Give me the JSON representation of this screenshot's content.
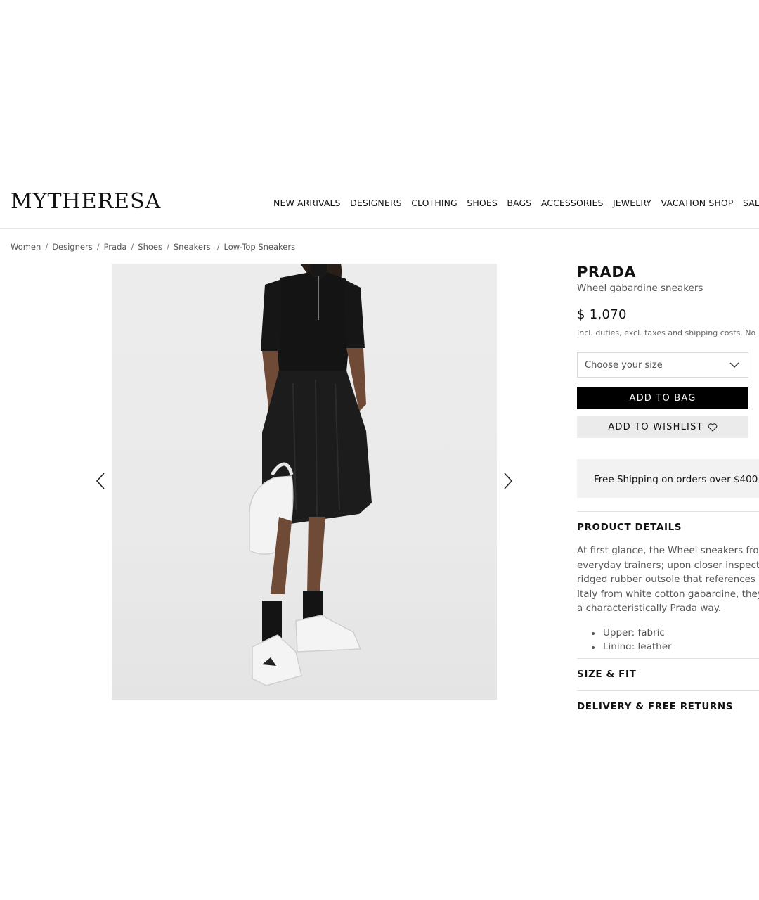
{
  "header": {
    "logo": "MYTHERESA",
    "nav": [
      "NEW ARRIVALS",
      "DESIGNERS",
      "CLOTHING",
      "SHOES",
      "BAGS",
      "ACCESSORIES",
      "JEWELRY",
      "VACATION SHOP",
      "SALE"
    ]
  },
  "breadcrumb": [
    "Women",
    "Designers",
    "Prada",
    "Shoes",
    "Sneakers",
    "Low-Top Sneakers"
  ],
  "product": {
    "brand": "PRADA",
    "name": "Wheel gabardine sneakers",
    "price": "$ 1,070",
    "price_note": "Incl. duties, excl. taxes and shipping costs. No",
    "size_placeholder": "Choose your size",
    "add_to_bag": "ADD TO BAG",
    "add_to_wishlist": "ADD TO WISHLIST",
    "shipping": "Free Shipping on orders over $400"
  },
  "details": {
    "title": "PRODUCT DETAILS",
    "description_lines": [
      "At first glance, the Wheel sneakers from P",
      "everyday trainers; upon closer inspection",
      "ridged rubber outsole that references mo",
      "Italy from white cotton gabardine, they're",
      "a characteristically Prada way."
    ],
    "bullets": [
      "Upper: fabric",
      "Lining: leather"
    ]
  },
  "sections": {
    "size_fit": "SIZE & FIT",
    "delivery": "DELIVERY & FREE RETURNS"
  },
  "icons": {
    "prev": "chevron-left-icon",
    "next": "chevron-right-icon",
    "dropdown": "chevron-down-icon",
    "wishlist": "heart-icon"
  }
}
